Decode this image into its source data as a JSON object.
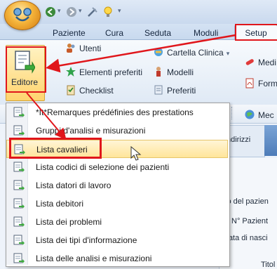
{
  "tabs": [
    {
      "label": "Paziente"
    },
    {
      "label": "Cura"
    },
    {
      "label": "Seduta"
    },
    {
      "label": "Moduli"
    },
    {
      "label": "Setup"
    }
  ],
  "ribbon": {
    "editore_label": "Editore",
    "col1": [
      {
        "label": "Utenti",
        "icon": "users-icon"
      },
      {
        "label": "Elementi preferiti",
        "icon": "star-icon"
      },
      {
        "label": "Checklist",
        "icon": "checklist-icon"
      }
    ],
    "col2": [
      {
        "label": "Cartella Clinica",
        "icon": "folder-icon"
      },
      {
        "label": "Modelli",
        "icon": "person-template-icon"
      },
      {
        "label": "Preferiti",
        "icon": "favorites-icon"
      }
    ],
    "col3": [
      {
        "label": "Medi",
        "icon": "pill-icon"
      },
      {
        "label": "Form",
        "icon": "pdf-icon"
      }
    ]
  },
  "background": {
    "toolbar_item": "Mec",
    "tab_label": "ndirizzi",
    "field_labels": [
      "zo del pazien",
      "N° Pazient",
      "Data di nasci",
      "Titol"
    ]
  },
  "menu": {
    "items": [
      {
        "label": "*It*Remarques prédéfinies des prestations"
      },
      {
        "label": "Gruppi d'analisi e misurazioni"
      },
      {
        "label": "Lista cavalieri"
      },
      {
        "label": "Lista codici di selezione dei pazienti"
      },
      {
        "label": "Lista datori di lavoro"
      },
      {
        "label": "Lista debitori"
      },
      {
        "label": "Lista dei problemi"
      },
      {
        "label": "Lista dei tipi d'informazione"
      },
      {
        "label": "Lista delle analisi e misurazioni"
      }
    ],
    "highlighted_index": 2
  },
  "colors": {
    "annotation_red": "#e0161b",
    "hover_yellow": "#ffe59a",
    "ribbon_blue": "#dfe9f5"
  }
}
